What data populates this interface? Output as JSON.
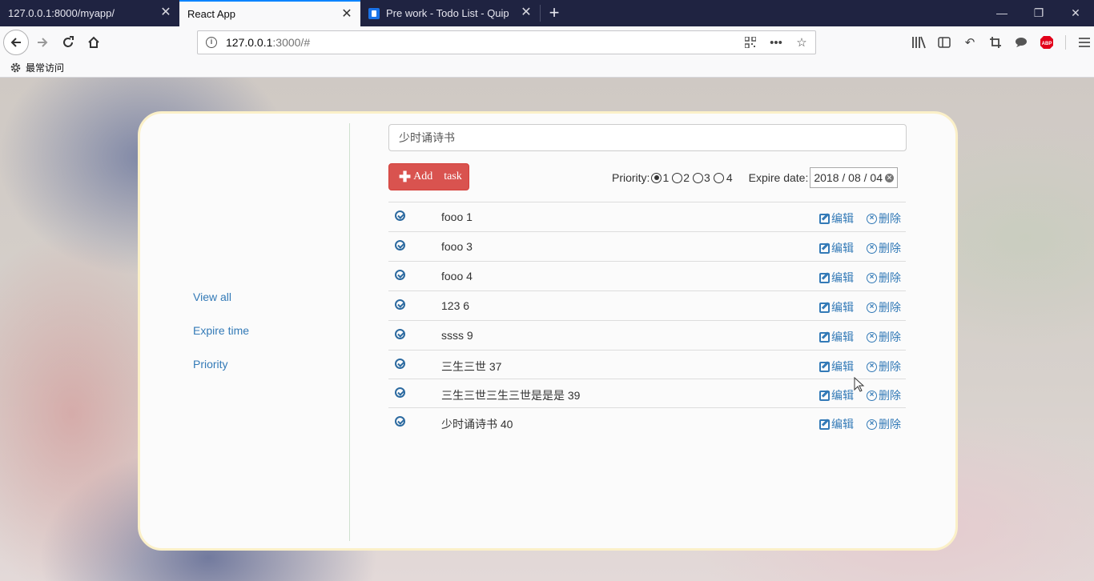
{
  "browser": {
    "tabs": [
      {
        "label": "127.0.0.1:8000/myapp/",
        "active": false
      },
      {
        "label": "React App",
        "active": true
      },
      {
        "label": "Pre work - Todo List - Quip",
        "active": false
      }
    ],
    "url_host": "127.0.0.1",
    "url_rest": ":3000/#",
    "bookmarks_label": "最常访问"
  },
  "sidebar": {
    "links": [
      "View all",
      "Expire time",
      "Priority"
    ]
  },
  "main": {
    "input_value": "少时诵诗书",
    "add_button": {
      "word1": "Add",
      "word2": "task"
    },
    "priority_label": "Priority:",
    "priority_options": [
      "1",
      "2",
      "3",
      "4"
    ],
    "priority_selected": "1",
    "expire_label": "Expire date:",
    "expire_value": "2018 / 08 / 04",
    "edit_label": "编辑",
    "delete_label": "删除",
    "tasks": [
      {
        "text": "fooo 1"
      },
      {
        "text": "fooo 3"
      },
      {
        "text": "fooo 4"
      },
      {
        "text": "123 6"
      },
      {
        "text": "ssss 9"
      },
      {
        "text": "三生三世 37"
      },
      {
        "text": "三生三世三生三世是是是 39"
      },
      {
        "text": "少时诵诗书 40"
      }
    ]
  },
  "colors": {
    "accent_blue": "#337ab7",
    "danger_red": "#d9534f",
    "card_border": "#fbf0c8"
  }
}
